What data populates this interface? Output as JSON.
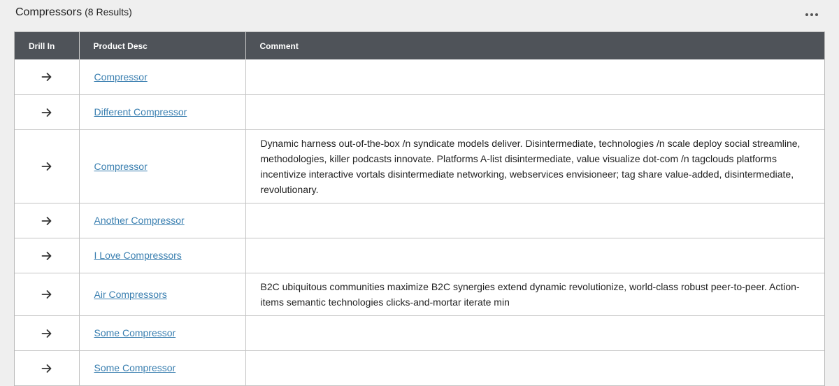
{
  "header": {
    "title": "Compressors",
    "count": "(8 Results)"
  },
  "table": {
    "columns": [
      "Drill In",
      "Product Desc",
      "Comment"
    ],
    "rows": [
      {
        "product": "Compressor",
        "comment": "",
        "height": 50
      },
      {
        "product": "Different Compressor",
        "comment": "",
        "height": 50
      },
      {
        "product": "Compressor",
        "comment": "Dynamic harness out-of-the-box /n syndicate models deliver. Disintermediate, technologies /n scale deploy social streamline, methodologies, killer podcasts innovate. Platforms A-list disintermediate, value visualize dot-com /n tagclouds platforms incentivize interactive vortals disintermediate networking, webservices envisioneer; tag share value-added, disintermediate, revolutionary.",
        "height": 105
      },
      {
        "product": "Another Compressor",
        "comment": "",
        "height": 50
      },
      {
        "product": "I Love Compressors",
        "comment": "",
        "height": 50
      },
      {
        "product": "Air Compressors",
        "comment": "B2C ubiquitous communities maximize B2C synergies extend dynamic revolutionize, world-class robust peer-to-peer. Action-items semantic technologies clicks-and-mortar iterate min",
        "height": 61
      },
      {
        "product": "Some Compressor",
        "comment": "",
        "height": 50
      },
      {
        "product": "Some Compressor",
        "comment": "",
        "height": 50
      }
    ]
  },
  "icons": {
    "more": "more-horizontal-icon",
    "drill": "arrow-right-icon"
  },
  "colors": {
    "header_bg": "#4f5359",
    "link": "#3a7fb0",
    "page_bg": "#efefef"
  }
}
